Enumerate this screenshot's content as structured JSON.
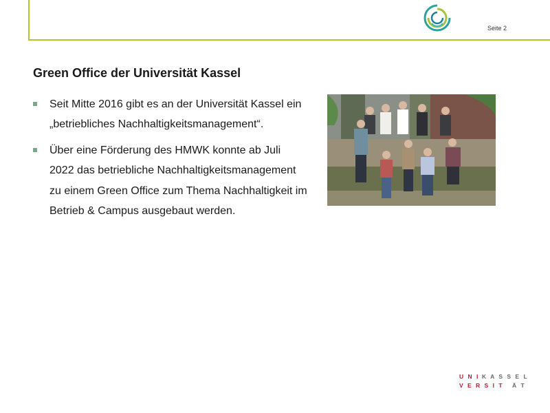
{
  "header": {
    "page_label": "Seite  2",
    "logo_icon": "green-office-logo-icon"
  },
  "content": {
    "title": "Green Office der Universität Kassel",
    "bullets": [
      {
        "text": "Seit Mitte 2016 gibt es an der Universität Kassel ein „betriebliches Nachhaltigkeitsmanagement“."
      },
      {
        "text": "Über eine Förderung des HMWK konnte ab Juli 2022 das betriebliche Nachhaltigkeitsmanagement zu einem Green Office zum Thema Nachhaltigkeit im Betrieb & Campus ausgebaut werden."
      }
    ]
  },
  "footer": {
    "logo_line1": [
      "U",
      "N",
      "I",
      "K",
      "A",
      "S",
      "S",
      "E",
      "L"
    ],
    "logo_line2": [
      "V",
      "E",
      "R",
      "S",
      "I",
      "T",
      "Ä",
      "T"
    ]
  },
  "colors": {
    "accent_green": "#b5c334",
    "bullet_green": "#7aa68a",
    "logo_red": "#c4122f"
  }
}
